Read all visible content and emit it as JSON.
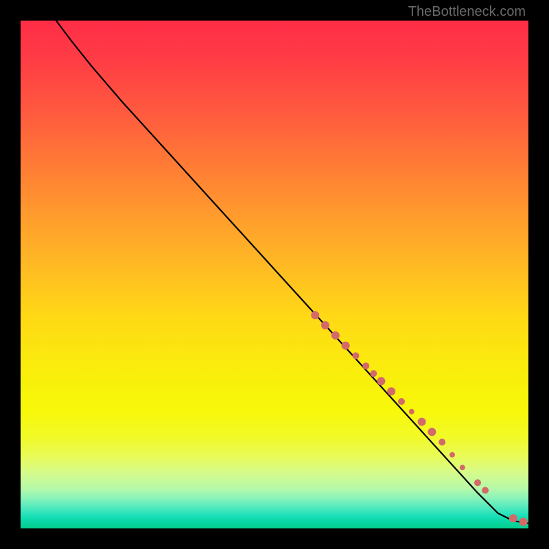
{
  "watermark": "TheBottleneck.com",
  "chart_data": {
    "type": "line",
    "title": "",
    "xlabel": "",
    "ylabel": "",
    "xlim": [
      0,
      100
    ],
    "ylim": [
      0,
      100
    ],
    "background_gradient": {
      "top": "#ff2d47",
      "mid": "#ffd816",
      "bottom": "#04cf8e"
    },
    "curve": [
      {
        "x": 7,
        "y": 100
      },
      {
        "x": 10,
        "y": 96
      },
      {
        "x": 14,
        "y": 91
      },
      {
        "x": 20,
        "y": 84
      },
      {
        "x": 30,
        "y": 73
      },
      {
        "x": 40,
        "y": 62
      },
      {
        "x": 50,
        "y": 51
      },
      {
        "x": 60,
        "y": 40
      },
      {
        "x": 70,
        "y": 29
      },
      {
        "x": 80,
        "y": 18
      },
      {
        "x": 90,
        "y": 7
      },
      {
        "x": 94,
        "y": 3
      },
      {
        "x": 97,
        "y": 1.5
      },
      {
        "x": 100,
        "y": 1
      }
    ],
    "markers": [
      {
        "x": 58,
        "y": 42,
        "r": 6
      },
      {
        "x": 60,
        "y": 40,
        "r": 6
      },
      {
        "x": 62,
        "y": 38,
        "r": 6
      },
      {
        "x": 64,
        "y": 36,
        "r": 6
      },
      {
        "x": 66,
        "y": 34,
        "r": 5
      },
      {
        "x": 68,
        "y": 32,
        "r": 5
      },
      {
        "x": 69.5,
        "y": 30.5,
        "r": 5
      },
      {
        "x": 71,
        "y": 29,
        "r": 6
      },
      {
        "x": 73,
        "y": 27,
        "r": 6
      },
      {
        "x": 75,
        "y": 25,
        "r": 5
      },
      {
        "x": 77,
        "y": 23,
        "r": 4
      },
      {
        "x": 79,
        "y": 21,
        "r": 6
      },
      {
        "x": 81,
        "y": 19,
        "r": 6
      },
      {
        "x": 83,
        "y": 17,
        "r": 5
      },
      {
        "x": 85,
        "y": 14.5,
        "r": 4
      },
      {
        "x": 87,
        "y": 12,
        "r": 4
      },
      {
        "x": 90,
        "y": 9,
        "r": 5
      },
      {
        "x": 91.5,
        "y": 7.5,
        "r": 5
      },
      {
        "x": 97,
        "y": 2,
        "r": 6
      },
      {
        "x": 99,
        "y": 1.3,
        "r": 6
      }
    ],
    "marker_color": "#d36a6a"
  }
}
